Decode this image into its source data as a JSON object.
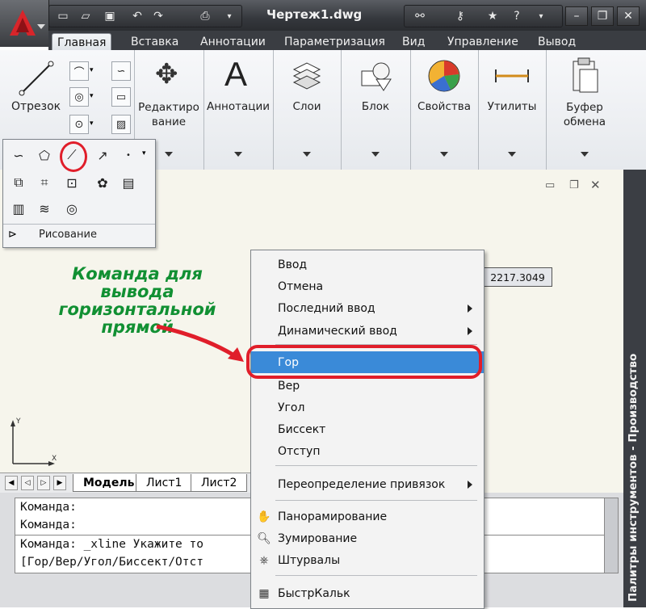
{
  "window": {
    "title": "Чертеж1.dwg"
  },
  "quick_access": [
    "new-icon",
    "open-icon",
    "save-icon",
    "undo-icon",
    "redo-icon",
    "print-icon"
  ],
  "menu_tabs": [
    {
      "label": "Главная",
      "active": true
    },
    {
      "label": "Вставка"
    },
    {
      "label": "Аннотации"
    },
    {
      "label": "Параметризация"
    },
    {
      "label": "Вид"
    },
    {
      "label": "Управление"
    },
    {
      "label": "Вывод"
    }
  ],
  "ribbon": {
    "line_label": "Отрезок",
    "panels": [
      {
        "label": "Редактиро\nвание"
      },
      {
        "label": "Аннотации"
      },
      {
        "label": "Слои"
      },
      {
        "label": "Блок"
      },
      {
        "label": "Свойства"
      },
      {
        "label": "Утилиты"
      },
      {
        "label": "Буфер\nобмена"
      }
    ]
  },
  "flyout": {
    "title": "Рисование"
  },
  "annotation": {
    "text": "Команда для вывода горизонтальной прямой",
    "color": "#119033"
  },
  "coord_readout": "2217.3049",
  "context_menu": {
    "items": [
      {
        "label": "Ввод"
      },
      {
        "label": "Отмена"
      },
      {
        "label": "Последний ввод",
        "submenu": true
      },
      {
        "label": "Динамический ввод",
        "submenu": true
      },
      {
        "separator": true
      },
      {
        "label": "Гор",
        "highlighted": true
      },
      {
        "label": "Вер"
      },
      {
        "label": "Угол"
      },
      {
        "label": "Биссект"
      },
      {
        "label": "Отступ"
      },
      {
        "separator": true
      },
      {
        "label": "Переопределение привязок",
        "submenu": true
      },
      {
        "separator": true
      },
      {
        "label": "Панорамирование",
        "icon": "pan-icon"
      },
      {
        "label": "Зумирование",
        "icon": "zoom-icon"
      },
      {
        "label": "Штурвалы",
        "icon": "steering-wheel-icon"
      },
      {
        "separator": true
      },
      {
        "label": "БыстрКальк",
        "icon": "calculator-icon"
      }
    ],
    "highlight_color": "#3a8ad8"
  },
  "layout_tabs": [
    "Модель",
    "Лист1",
    "Лист2"
  ],
  "command_lines": [
    "Команда:",
    "Команда:",
    "Команда:  _xline Укажите то",
    "[Гор/Вер/Угол/Биссект/Отст"
  ],
  "side_palette": {
    "label": "Палитры инструментов - Производство"
  },
  "accent": "#e01e2a"
}
